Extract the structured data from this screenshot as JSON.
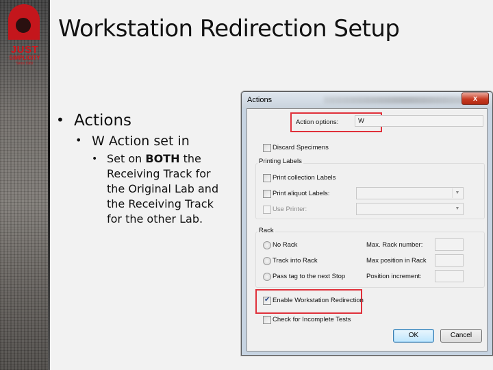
{
  "slide": {
    "title": "Workstation Redirection Setup",
    "logo": {
      "line1": "JUST",
      "line2": "SIMPLICITY",
      "line3": "Since 1982"
    },
    "bullets": {
      "level1": "Actions",
      "level2": "W Action set in",
      "level3_prefix": "Set on ",
      "level3_bold": "BOTH",
      "level3_suffix": " the Receiving Track for the Original Lab and the Receiving Track for the other Lab."
    }
  },
  "dialog": {
    "title": "Actions",
    "close_label": "x",
    "action_options_label": "Action options:",
    "action_options_value": "W",
    "discard_specimens": {
      "label": "Discard Specimens",
      "checked": false
    },
    "printing_labels": {
      "group_label": "Printing Labels",
      "print_collection": {
        "label": "Print collection Labels",
        "checked": false
      },
      "print_aliquot": {
        "label": "Print aliquot Labels:",
        "checked": false,
        "value": ""
      },
      "use_printer": {
        "label": "Use Printer:",
        "checked": false,
        "enabled": false,
        "value": ""
      }
    },
    "rack": {
      "group_label": "Rack",
      "options": [
        "No Rack",
        "Track into Rack",
        "Pass tag to the next Stop"
      ],
      "max_rack_number_label": "Max. Rack number:",
      "max_position_label": "Max position in Rack",
      "position_increment_label": "Position increment:",
      "max_rack_number_value": "",
      "max_position_value": "",
      "position_increment_value": ""
    },
    "enable_redirection": {
      "label": "Enable Workstation Redirection",
      "checked": true
    },
    "check_incomplete": {
      "label": "Check for Incomplete Tests",
      "checked": false
    },
    "ok_label": "OK",
    "cancel_label": "Cancel"
  },
  "colors": {
    "highlight": "#e0303a",
    "logo_red": "#c4161c"
  }
}
